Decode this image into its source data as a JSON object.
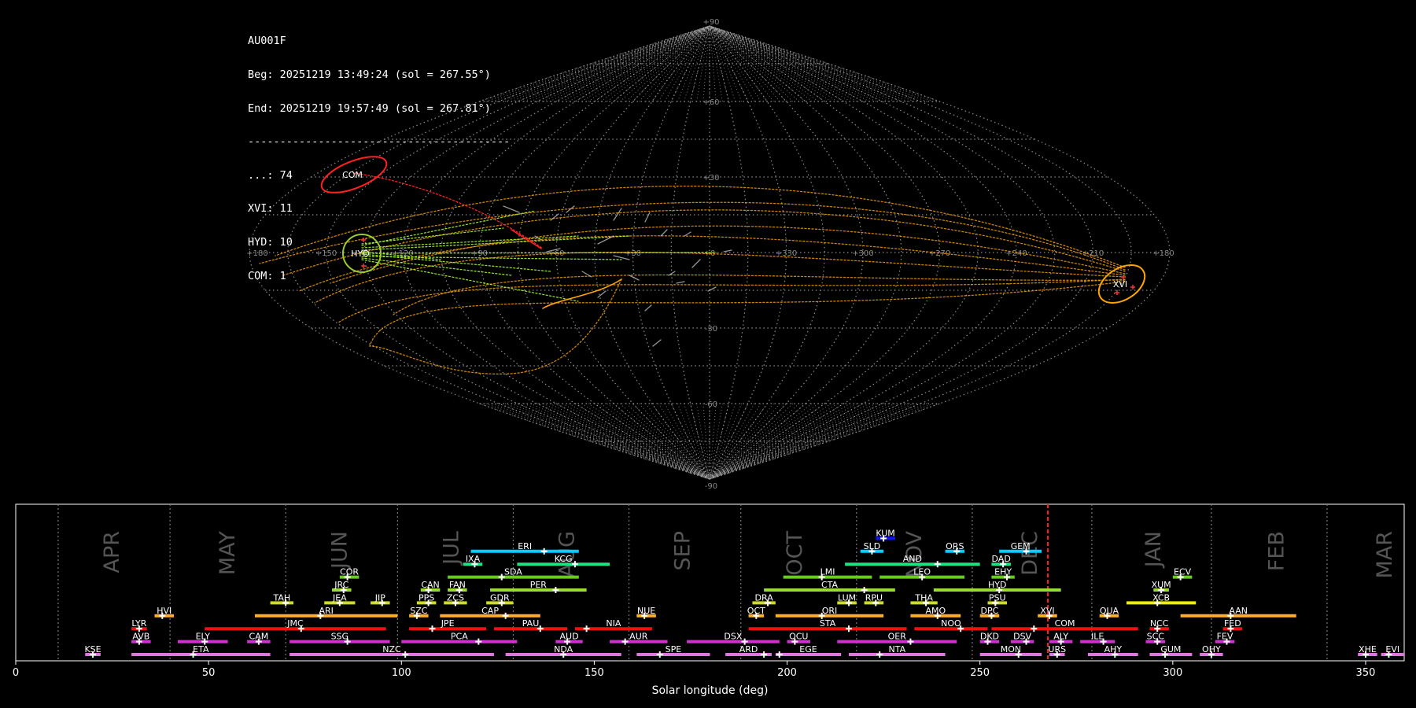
{
  "info": {
    "station": "AU001F",
    "beg": "Beg: 20251219 13:49:24 (sol = 267.55°)",
    "end": "End: 20251219 19:57:49 (sol = 267.81°)",
    "separator": "-----------------------------------------",
    "counts": [
      "...: 74",
      "XVI: 11",
      "HYD: 10",
      "COM: 1"
    ]
  },
  "chart_data": [
    {
      "type": "scatter",
      "projection": "sinusoidal",
      "grid": true,
      "lon_labels": [
        "+180",
        "+150",
        "+120",
        "+90",
        "+60",
        "+30",
        "+0",
        "+330",
        "+300",
        "+270",
        "+240",
        "+210",
        "+180"
      ],
      "lat_labels": [
        "+90",
        "+60",
        "+30",
        "-30",
        "-60",
        "-90"
      ],
      "shower_circles": [
        {
          "code": "COM",
          "lon": 150,
          "lat": 22,
          "color": "#ff2020"
        },
        {
          "code": "HYD",
          "lon": 131,
          "lat": 0,
          "color": "#9acd32"
        },
        {
          "code": "XVI",
          "lon": 204,
          "lat": -8,
          "color": "#ffa500"
        }
      ],
      "colors": {
        "sporadic": "#bbbbbb",
        "COM": "#ff2020",
        "HYD": "#adff2f",
        "XVI": "#ffa500"
      }
    },
    {
      "type": "bar",
      "xlabel": "Solar longitude (deg)",
      "xlim": [
        0,
        360
      ],
      "xticks": [
        0,
        50,
        100,
        150,
        200,
        250,
        300,
        350
      ],
      "month_boundaries": [
        11,
        40,
        70,
        99,
        129,
        159,
        188,
        218,
        248,
        279,
        310,
        340
      ],
      "months": [
        {
          "name": "APR",
          "sol": 25
        },
        {
          "name": "MAY",
          "sol": 55
        },
        {
          "name": "JUN",
          "sol": 84
        },
        {
          "name": "JUL",
          "sol": 113
        },
        {
          "name": "AUG",
          "sol": 143
        },
        {
          "name": "SEP",
          "sol": 173
        },
        {
          "name": "OCT",
          "sol": 202
        },
        {
          "name": "NOV",
          "sol": 233
        },
        {
          "name": "DEC",
          "sol": 263
        },
        {
          "name": "JAN",
          "sol": 295
        },
        {
          "name": "FEB",
          "sol": 327
        },
        {
          "name": "MAR",
          "sol": 355
        }
      ],
      "current_sol": 267.6,
      "showers": [
        {
          "code": "KUM",
          "row": 9,
          "start": 223,
          "end": 228,
          "peak": 225,
          "color": "#1010ff"
        },
        {
          "code": "ERI",
          "row": 8,
          "start": 118,
          "end": 146,
          "peak": 137,
          "color": "#00d0ff"
        },
        {
          "code": "SLD",
          "row": 8,
          "start": 219,
          "end": 225,
          "peak": 222,
          "color": "#00d0ff"
        },
        {
          "code": "ORS",
          "row": 8,
          "start": 241,
          "end": 246,
          "peak": 244,
          "color": "#00d0ff"
        },
        {
          "code": "GEM",
          "row": 8,
          "start": 255,
          "end": 266,
          "peak": 262,
          "color": "#00d0ff"
        },
        {
          "code": "IXA",
          "row": 7,
          "start": 116,
          "end": 121,
          "peak": 119,
          "color": "#20e080"
        },
        {
          "code": "KCG",
          "row": 7,
          "start": 130,
          "end": 154,
          "peak": 145,
          "color": "#20e080"
        },
        {
          "code": "AND",
          "row": 7,
          "start": 215,
          "end": 250,
          "peak": 239,
          "color": "#20e080"
        },
        {
          "code": "DAD",
          "row": 7,
          "start": 253,
          "end": 258,
          "peak": 256,
          "color": "#20e080"
        },
        {
          "code": "COR",
          "row": 6,
          "start": 84,
          "end": 89,
          "peak": 86,
          "color": "#66cc22"
        },
        {
          "code": "SDA",
          "row": 6,
          "start": 112,
          "end": 146,
          "peak": 126,
          "color": "#66cc22"
        },
        {
          "code": "LMI",
          "row": 6,
          "start": 199,
          "end": 222,
          "peak": 209,
          "color": "#66cc22"
        },
        {
          "code": "LEO",
          "row": 6,
          "start": 224,
          "end": 246,
          "peak": 235,
          "color": "#66cc22"
        },
        {
          "code": "EHY",
          "row": 6,
          "start": 253,
          "end": 259,
          "peak": 257,
          "color": "#66cc22"
        },
        {
          "code": "ECV",
          "row": 6,
          "start": 300,
          "end": 305,
          "peak": 302,
          "color": "#66cc22"
        },
        {
          "code": "JRC",
          "row": 5,
          "start": 82,
          "end": 87,
          "peak": 85,
          "color": "#99dd33"
        },
        {
          "code": "CAN",
          "row": 5,
          "start": 105,
          "end": 110,
          "peak": 107,
          "color": "#99dd33"
        },
        {
          "code": "FAN",
          "row": 5,
          "start": 112,
          "end": 117,
          "peak": 115,
          "color": "#99dd33"
        },
        {
          "code": "PER",
          "row": 5,
          "start": 123,
          "end": 148,
          "peak": 140,
          "color": "#99dd33"
        },
        {
          "code": "CTA",
          "row": 5,
          "start": 194,
          "end": 228,
          "peak": 220,
          "color": "#99dd33"
        },
        {
          "code": "HYD",
          "row": 5,
          "start": 238,
          "end": 271,
          "peak": 255,
          "color": "#99dd33"
        },
        {
          "code": "XUM",
          "row": 5,
          "start": 295,
          "end": 299,
          "peak": 297,
          "color": "#99dd33"
        },
        {
          "code": "TAH",
          "row": 4,
          "start": 66,
          "end": 72,
          "peak": 70,
          "color": "#ccdd22"
        },
        {
          "code": "JEA",
          "row": 4,
          "start": 80,
          "end": 88,
          "peak": 84,
          "color": "#ccdd22"
        },
        {
          "code": "JIP",
          "row": 4,
          "start": 92,
          "end": 97,
          "peak": 95,
          "color": "#ccdd22"
        },
        {
          "code": "PPS",
          "row": 4,
          "start": 104,
          "end": 109,
          "peak": 107,
          "color": "#ccdd22"
        },
        {
          "code": "ZCS",
          "row": 4,
          "start": 111,
          "end": 117,
          "peak": 114,
          "color": "#ccdd22"
        },
        {
          "code": "GDR",
          "row": 4,
          "start": 122,
          "end": 129,
          "peak": 126,
          "color": "#ccdd22"
        },
        {
          "code": "DRA",
          "row": 4,
          "start": 191,
          "end": 197,
          "peak": 195,
          "color": "#ccdd22"
        },
        {
          "code": "LUM",
          "row": 4,
          "start": 213,
          "end": 218,
          "peak": 216,
          "color": "#ccdd22"
        },
        {
          "code": "RPU",
          "row": 4,
          "start": 220,
          "end": 225,
          "peak": 223,
          "color": "#ccdd22"
        },
        {
          "code": "THA",
          "row": 4,
          "start": 232,
          "end": 239,
          "peak": 236,
          "color": "#ccdd22"
        },
        {
          "code": "PSU",
          "row": 4,
          "start": 252,
          "end": 257,
          "peak": 254,
          "color": "#ccdd22"
        },
        {
          "code": "XCB",
          "row": 4,
          "start": 288,
          "end": 306,
          "peak": 296,
          "color": "#eeee00"
        },
        {
          "code": "HVI",
          "row": 3,
          "start": 36,
          "end": 41,
          "peak": 38,
          "color": "#ffb020"
        },
        {
          "code": "ARI",
          "row": 3,
          "start": 62,
          "end": 99,
          "peak": 79,
          "color": "#ffb020"
        },
        {
          "code": "SZC",
          "row": 3,
          "start": 102,
          "end": 107,
          "peak": 104,
          "color": "#ffb020"
        },
        {
          "code": "CAP",
          "row": 3,
          "start": 110,
          "end": 136,
          "peak": 127,
          "color": "#ffb020"
        },
        {
          "code": "NUE",
          "row": 3,
          "start": 161,
          "end": 166,
          "peak": 163,
          "color": "#ffb020"
        },
        {
          "code": "OCT",
          "row": 3,
          "start": 190,
          "end": 194,
          "peak": 192,
          "color": "#ffb020"
        },
        {
          "code": "ORI",
          "row": 3,
          "start": 197,
          "end": 225,
          "peak": 209,
          "color": "#ffb020"
        },
        {
          "code": "AMO",
          "row": 3,
          "start": 232,
          "end": 245,
          "peak": 239,
          "color": "#ffb020"
        },
        {
          "code": "DPC",
          "row": 3,
          "start": 250,
          "end": 255,
          "peak": 253,
          "color": "#ffb020"
        },
        {
          "code": "XVI",
          "row": 3,
          "start": 265,
          "end": 270,
          "peak": 268,
          "color": "#ffb020"
        },
        {
          "code": "QUA",
          "row": 3,
          "start": 281,
          "end": 286,
          "peak": 283,
          "color": "#ffb020"
        },
        {
          "code": "AAN",
          "row": 3,
          "start": 302,
          "end": 332,
          "peak": 315,
          "color": "#ffb020"
        },
        {
          "code": "LYR",
          "row": 2,
          "start": 30,
          "end": 34,
          "peak": 32,
          "color": "#ee1111"
        },
        {
          "code": "JMC",
          "row": 2,
          "start": 49,
          "end": 96,
          "peak": 74,
          "color": "#ee1111"
        },
        {
          "code": "JPE",
          "row": 2,
          "start": 102,
          "end": 122,
          "peak": 108,
          "color": "#ee1111"
        },
        {
          "code": "PAU",
          "row": 2,
          "start": 124,
          "end": 143,
          "peak": 136,
          "color": "#ee1111"
        },
        {
          "code": "NIA",
          "row": 2,
          "start": 145,
          "end": 165,
          "peak": 148,
          "color": "#ee1111"
        },
        {
          "code": "STA",
          "row": 2,
          "start": 190,
          "end": 231,
          "peak": 216,
          "color": "#ee1111"
        },
        {
          "code": "NOO",
          "row": 2,
          "start": 233,
          "end": 252,
          "peak": 245,
          "color": "#ee1111"
        },
        {
          "code": "COM",
          "row": 2,
          "start": 253,
          "end": 291,
          "peak": 264,
          "color": "#ee1111"
        },
        {
          "code": "NCC",
          "row": 2,
          "start": 294,
          "end": 299,
          "peak": 296,
          "color": "#ee1111"
        },
        {
          "code": "FED",
          "row": 2,
          "start": 313,
          "end": 318,
          "peak": 315,
          "color": "#ee1111"
        },
        {
          "code": "AVB",
          "row": 1,
          "start": 30,
          "end": 35,
          "peak": 32,
          "color": "#cc33cc"
        },
        {
          "code": "ELY",
          "row": 1,
          "start": 42,
          "end": 55,
          "peak": 49,
          "color": "#cc33cc"
        },
        {
          "code": "CAM",
          "row": 1,
          "start": 60,
          "end": 66,
          "peak": 63,
          "color": "#cc33cc"
        },
        {
          "code": "SSG",
          "row": 1,
          "start": 71,
          "end": 97,
          "peak": 86,
          "color": "#cc33cc"
        },
        {
          "code": "PCA",
          "row": 1,
          "start": 100,
          "end": 130,
          "peak": 120,
          "color": "#cc33cc"
        },
        {
          "code": "AUD",
          "row": 1,
          "start": 140,
          "end": 147,
          "peak": 143,
          "color": "#cc33cc"
        },
        {
          "code": "AUR",
          "row": 1,
          "start": 154,
          "end": 169,
          "peak": 158,
          "color": "#cc33cc"
        },
        {
          "code": "DSX",
          "row": 1,
          "start": 174,
          "end": 198,
          "peak": 189,
          "color": "#cc33cc"
        },
        {
          "code": "OCU",
          "row": 1,
          "start": 200,
          "end": 206,
          "peak": 202,
          "color": "#cc33cc"
        },
        {
          "code": "OER",
          "row": 1,
          "start": 213,
          "end": 244,
          "peak": 232,
          "color": "#cc33cc"
        },
        {
          "code": "DKD",
          "row": 1,
          "start": 250,
          "end": 255,
          "peak": 252,
          "color": "#cc33cc"
        },
        {
          "code": "DSV",
          "row": 1,
          "start": 258,
          "end": 264,
          "peak": 262,
          "color": "#cc33cc"
        },
        {
          "code": "ALY",
          "row": 1,
          "start": 268,
          "end": 274,
          "peak": 271,
          "color": "#cc33cc"
        },
        {
          "code": "ILE",
          "row": 1,
          "start": 276,
          "end": 285,
          "peak": 282,
          "color": "#cc33cc"
        },
        {
          "code": "SCC",
          "row": 1,
          "start": 293,
          "end": 298,
          "peak": 296,
          "color": "#cc33cc"
        },
        {
          "code": "FEV",
          "row": 1,
          "start": 311,
          "end": 316,
          "peak": 314,
          "color": "#cc33cc"
        },
        {
          "code": "KSE",
          "row": 0,
          "start": 18,
          "end": 22,
          "peak": 20,
          "color": "#dd77dd"
        },
        {
          "code": "ETA",
          "row": 0,
          "start": 30,
          "end": 66,
          "peak": 46,
          "color": "#dd77dd"
        },
        {
          "code": "NZC",
          "row": 0,
          "start": 71,
          "end": 124,
          "peak": 101,
          "color": "#dd77dd"
        },
        {
          "code": "NDA",
          "row": 0,
          "start": 127,
          "end": 157,
          "peak": 142,
          "color": "#dd77dd"
        },
        {
          "code": "SPE",
          "row": 0,
          "start": 161,
          "end": 180,
          "peak": 167,
          "color": "#dd77dd"
        },
        {
          "code": "ARD",
          "row": 0,
          "start": 184,
          "end": 196,
          "peak": 194,
          "color": "#dd77dd"
        },
        {
          "code": "EGE",
          "row": 0,
          "start": 197,
          "end": 214,
          "peak": 198,
          "color": "#dd77dd"
        },
        {
          "code": "NTA",
          "row": 0,
          "start": 216,
          "end": 241,
          "peak": 224,
          "color": "#dd77dd"
        },
        {
          "code": "MON",
          "row": 0,
          "start": 250,
          "end": 266,
          "peak": 260,
          "color": "#dd77dd"
        },
        {
          "code": "URS",
          "row": 0,
          "start": 268,
          "end": 272,
          "peak": 270,
          "color": "#dd77dd"
        },
        {
          "code": "AHY",
          "row": 0,
          "start": 278,
          "end": 291,
          "peak": 285,
          "color": "#dd77dd"
        },
        {
          "code": "GUM",
          "row": 0,
          "start": 294,
          "end": 305,
          "peak": 298,
          "color": "#dd77dd"
        },
        {
          "code": "OHY",
          "row": 0,
          "start": 307,
          "end": 313,
          "peak": 310,
          "color": "#dd77dd"
        },
        {
          "code": "XHE",
          "row": 0,
          "start": 348,
          "end": 353,
          "peak": 350,
          "color": "#dd77dd"
        },
        {
          "code": "EVI",
          "row": 0,
          "start": 354,
          "end": 360,
          "peak": 356,
          "color": "#dd77dd"
        }
      ]
    }
  ]
}
